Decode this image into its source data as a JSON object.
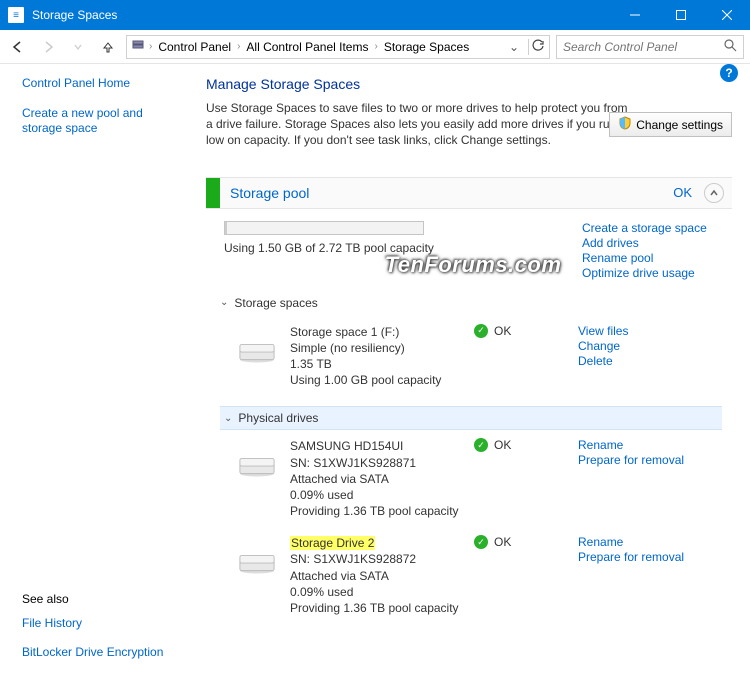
{
  "window": {
    "title": "Storage Spaces"
  },
  "breadcrumb": {
    "items": [
      "Control Panel",
      "All Control Panel Items",
      "Storage Spaces"
    ]
  },
  "search": {
    "placeholder": "Search Control Panel"
  },
  "sidebar": {
    "home": "Control Panel Home",
    "create": "Create a new pool and storage space",
    "seealso_label": "See also",
    "file_history": "File History",
    "bitlocker": "BitLocker Drive Encryption"
  },
  "page": {
    "title": "Manage Storage Spaces",
    "description": "Use Storage Spaces to save files to two or more drives to help protect you from a drive failure. Storage Spaces also lets you easily add more drives if you run low on capacity. If you don't see task links, click Change settings.",
    "change_settings": "Change settings"
  },
  "pool": {
    "name": "Storage pool",
    "status": "OK",
    "usage_text": "Using 1.50 GB of 2.72 TB pool capacity",
    "links": {
      "create": "Create a storage space",
      "add": "Add drives",
      "rename": "Rename pool",
      "optimize": "Optimize drive usage"
    },
    "section_spaces": "Storage spaces",
    "section_drives": "Physical drives",
    "spaces": [
      {
        "name": "Storage space 1 (F:)",
        "line2": "Simple (no resiliency)",
        "line3": "1.35 TB",
        "line4": "Using 1.00 GB pool capacity",
        "status": "OK",
        "links": {
          "a": "View files",
          "b": "Change",
          "c": "Delete"
        }
      }
    ],
    "drives": [
      {
        "name": "SAMSUNG HD154UI",
        "sn": "SN: S1XWJ1KS928871",
        "conn": "Attached via SATA",
        "used": "0.09% used",
        "prov": "Providing 1.36 TB pool capacity",
        "status": "OK",
        "highlight": false,
        "links": {
          "a": "Rename",
          "b": "Prepare for removal"
        }
      },
      {
        "name": "Storage Drive 2",
        "sn": "SN: S1XWJ1KS928872",
        "conn": "Attached via SATA",
        "used": "0.09% used",
        "prov": "Providing 1.36 TB pool capacity",
        "status": "OK",
        "highlight": true,
        "links": {
          "a": "Rename",
          "b": "Prepare for removal"
        }
      }
    ]
  },
  "watermark": "TenForums.com"
}
